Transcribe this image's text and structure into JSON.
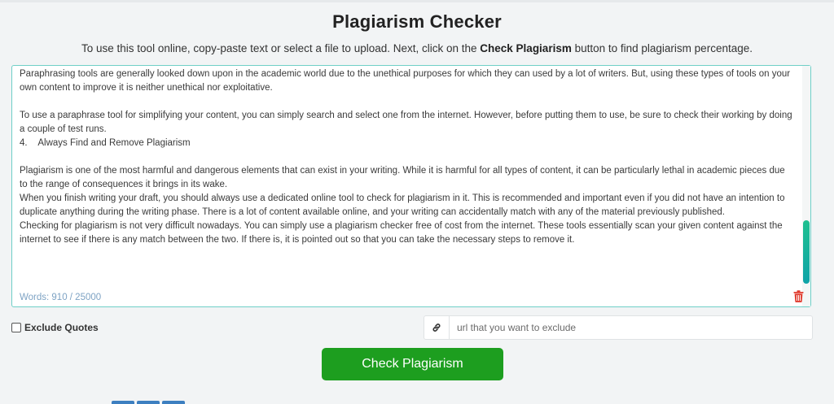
{
  "header": {
    "title": "Plagiarism Checker",
    "subtitle_before": "To use this tool online, copy-paste text or select a file to upload. Next, click on the ",
    "subtitle_bold": "Check Plagiarism",
    "subtitle_after": " button to find plagiarism percentage."
  },
  "editor": {
    "lines": [
      "Paraphrasing tools are generally looked down upon in the academic world due to the unethical purposes for which they can used by a lot of writers. But, using these types of tools on your own content to improve it is neither unethical nor exploitative.",
      "",
      "To use a paraphrase tool for simplifying your content, you can simply search and select one from the internet. However, before putting them to use, be sure to check their working by doing a couple of test runs.",
      "4.    Always Find and Remove Plagiarism",
      "",
      "Plagiarism is one of the most harmful and dangerous elements that can exist in your writing. While it is harmful for all types of content, it can be particularly lethal in academic pieces due to the range of consequences it brings in its wake.",
      "When you finish writing your draft, you should always use a dedicated online tool to check for plagiarism in it. This is recommended and important even if you did not have an intention to duplicate anything during the writing phase. There is a lot of content available online, and your writing can accidentally match with any of the material previously published.",
      "Checking for plagiarism is not very difficult nowadays. You can simply use a plagiarism checker free of cost from the internet. These tools essentially scan your given content against the internet to see if there is any match between the two. If there is, it is pointed out so that you can take the necessary steps to remove it."
    ],
    "word_count": "Words: 910 / 25000",
    "delete_icon": "trash-icon"
  },
  "options": {
    "exclude_quotes_label": "Exclude Quotes",
    "exclude_quotes_checked": false,
    "url_placeholder": "url that you want to exclude",
    "url_value": "",
    "link_icon": "link-icon"
  },
  "actions": {
    "check_label": "Check Plagiarism"
  },
  "colors": {
    "accent": "#1d9e1f",
    "editor_border": "#6fcfc7",
    "delete": "#e03b2e",
    "word_count": "#7ea3c4"
  }
}
